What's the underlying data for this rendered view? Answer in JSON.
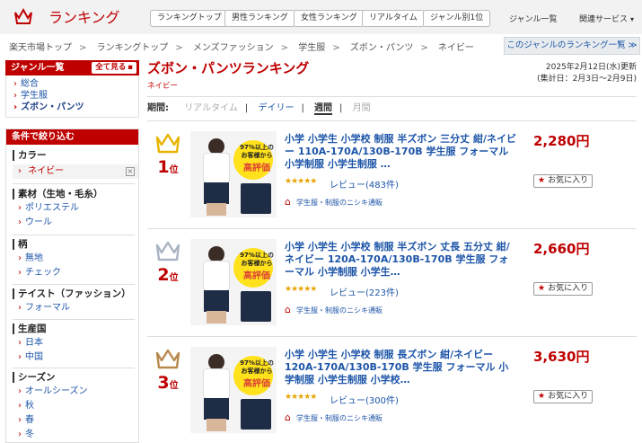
{
  "header": {
    "logo_text": "ランキング",
    "nav": [
      "ランキングトップ",
      "男性ランキング",
      "女性ランキング",
      "リアルタイム",
      "ジャンル別1位"
    ],
    "genre_list": "ジャンル一覧",
    "services": "関連サービス"
  },
  "breadcrumb": [
    "楽天市場トップ",
    "ランキングトップ",
    "メンズファッション",
    "学生服",
    "ズボン・パンツ",
    "ネイビー"
  ],
  "genre_ranking_button": "このジャンルのランキング一覧 ≫",
  "sidebar": {
    "genre_title": "ジャンル一覧",
    "see_all": "全て見る",
    "genres": [
      "総合",
      "学生服",
      "ズボン・パンツ"
    ],
    "filter_title": "条件で絞り込む",
    "sections": [
      {
        "title": "カラー",
        "items": [
          "ネイビー"
        ]
      },
      {
        "title": "素材（生地・毛糸）",
        "items": [
          "ポリエステル",
          "ウール"
        ]
      },
      {
        "title": "柄",
        "items": [
          "無地",
          "チェック"
        ]
      },
      {
        "title": "テイスト（ファッション）",
        "items": [
          "フォーマル"
        ]
      },
      {
        "title": "生産国",
        "items": [
          "日本",
          "中国"
        ]
      },
      {
        "title": "シーズン",
        "items": [
          "オールシーズン",
          "秋",
          "春",
          "冬"
        ]
      }
    ]
  },
  "main": {
    "title": "ズボン・パンツランキング",
    "subtitle": "ネイビー",
    "updated": "2025年2月12日(水)更新",
    "period_range": "(集計日：2月3日～2月9日)",
    "period_label": "期間:",
    "periods": [
      "リアルタイム",
      "デイリー",
      "週間",
      "月間"
    ]
  },
  "badge": {
    "line1": "97%以上の",
    "line2": "お客様から",
    "line3": "高評価"
  },
  "favorite_label": "お気に入り",
  "items": [
    {
      "rank": "1",
      "rank_suffix": "位",
      "crown_color": "#e8b400",
      "name": "小学 小学生 小学校 制服 半ズボン 三分丈 紺/ネイビー 110A-170A/130B-170B 学生服 フォーマル 小学制服 小学生制服 …",
      "stars": "★★★★★",
      "review": "レビュー(483件)",
      "shop": "学生服・制服のニシキ通販",
      "price": "2,280円"
    },
    {
      "rank": "2",
      "rank_suffix": "位",
      "crown_color": "#a9b3c4",
      "name": "小学 小学生 小学校 制服 半ズボン 丈長 五分丈 紺/ネイビー 120A-170A/130B-170B 学生服 フォーマル 小学制服 小学生…",
      "stars": "★★★★★",
      "review": "レビュー(223件)",
      "shop": "学生服・制服のニシキ通販",
      "price": "2,660円"
    },
    {
      "rank": "3",
      "rank_suffix": "位",
      "crown_color": "#b98a4e",
      "name": "小学 小学生 小学校 制服 長ズボン 紺/ネイビー 120A-170A/130B-170B 学生服 フォーマル 小学制服 小学生制服 小学校…",
      "stars": "★★★★★",
      "review": "レビュー(300件)",
      "shop": "学生服・制服のニシキ通販",
      "price": "3,630円"
    }
  ]
}
